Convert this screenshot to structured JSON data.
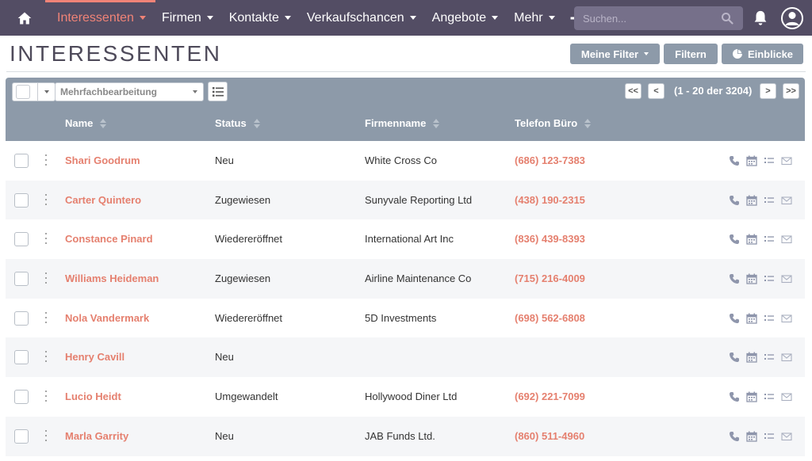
{
  "nav": {
    "items": [
      {
        "label": "Interessenten",
        "active": true
      },
      {
        "label": "Firmen",
        "active": false
      },
      {
        "label": "Kontakte",
        "active": false
      },
      {
        "label": "Verkaufschancen",
        "active": false
      },
      {
        "label": "Angebote",
        "active": false
      },
      {
        "label": "Mehr",
        "active": false
      }
    ],
    "search_placeholder": "Suchen...",
    "icons": [
      "home-icon",
      "plus-icon",
      "search-icon",
      "bell-icon",
      "user-icon"
    ]
  },
  "header": {
    "title": "INTERESSENTEN",
    "buttons": {
      "my_filter": "Meine Filter",
      "filter": "Filtern",
      "insights": "Einblicke"
    }
  },
  "toolbar": {
    "bulk_action": "Mehrfachbearbeitung",
    "pagination": {
      "first": "<<",
      "prev": "<",
      "range": "(1 - 20 der 3204)",
      "next": ">",
      "last": ">>"
    }
  },
  "columns": {
    "name": "Name",
    "status": "Status",
    "company": "Firmenname",
    "phone": "Telefon Büro"
  },
  "rows": [
    {
      "name": "Shari Goodrum",
      "status": "Neu",
      "company": "White Cross Co",
      "phone": "(686) 123-7383"
    },
    {
      "name": "Carter Quintero",
      "status": "Zugewiesen",
      "company": "Sunyvale Reporting Ltd",
      "phone": "(438) 190-2315"
    },
    {
      "name": "Constance Pinard",
      "status": "Wiedereröffnet",
      "company": "International Art Inc",
      "phone": "(836) 439-8393"
    },
    {
      "name": "Williams Heideman",
      "status": "Zugewiesen",
      "company": "Airline Maintenance Co",
      "phone": "(715) 216-4009"
    },
    {
      "name": "Nola Vandermark",
      "status": "Wiedereröffnet",
      "company": "5D Investments",
      "phone": "(698) 562-6808"
    },
    {
      "name": "Henry Cavill",
      "status": "Neu",
      "company": "",
      "phone": ""
    },
    {
      "name": "Lucio Heidt",
      "status": "Umgewandelt",
      "company": "Hollywood Diner Ltd",
      "phone": "(692) 221-7099"
    },
    {
      "name": "Marla Garrity",
      "status": "Neu",
      "company": "JAB Funds Ltd.",
      "phone": "(860) 511-4960"
    }
  ],
  "colors": {
    "nav_bg": "#534d64",
    "accent": "#f08377",
    "toolbar_bg": "#8d9aa9",
    "link": "#e5806f",
    "row_alt": "#f5f6f8"
  }
}
